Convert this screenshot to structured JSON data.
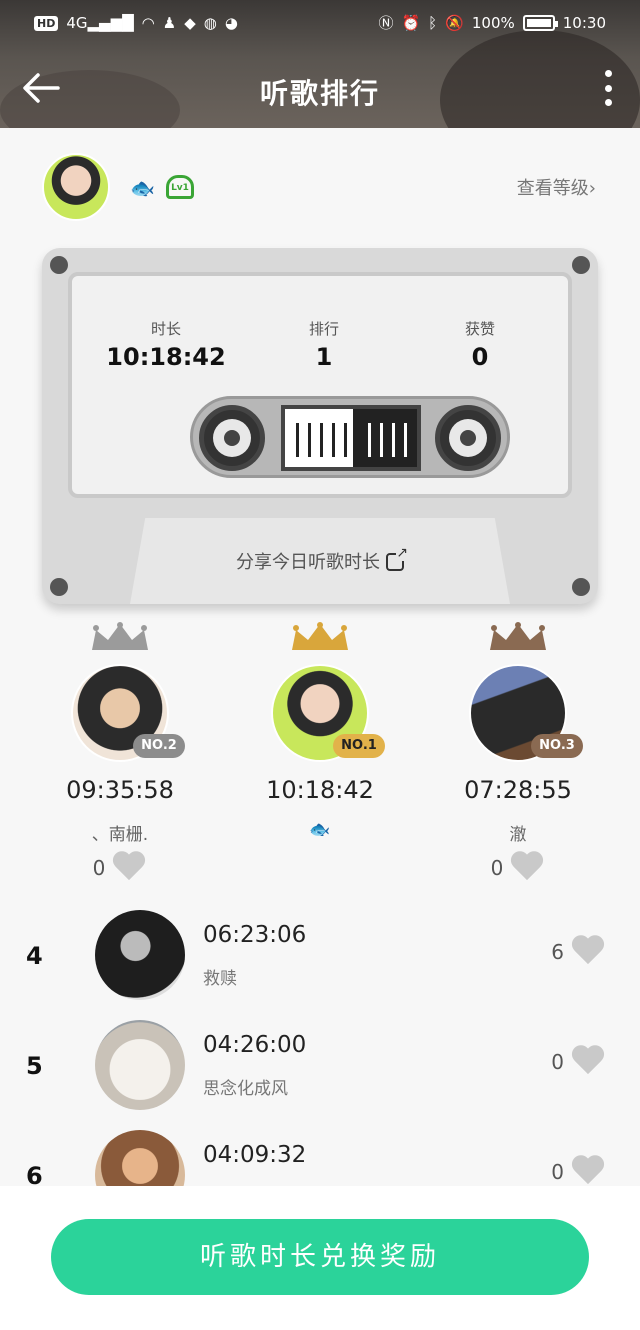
{
  "status_bar": {
    "hd": "HD",
    "network": "4G",
    "battery": "100%",
    "time": "10:30"
  },
  "header": {
    "title": "听歌排行",
    "back_icon": "arrow-left-icon",
    "more_icon": "more-vertical-icon"
  },
  "me": {
    "view_level": "查看等级›",
    "level": "Lv1"
  },
  "cassette": {
    "duration_label": "时长",
    "duration_value": "10:18:42",
    "rank_label": "排行",
    "rank_value": "1",
    "likes_label": "获赞",
    "likes_value": "0",
    "share": "分享今日听歌时长"
  },
  "podium": [
    {
      "badge": "NO.2",
      "time": "09:35:58",
      "name": "、南栅.",
      "likes": "0",
      "crown_color": "#9b9b9b",
      "badge_color": "#8c8c8c"
    },
    {
      "badge": "NO.1",
      "time": "10:18:42",
      "name": "",
      "likes": "",
      "crown_color": "#d9a63b",
      "badge_color": "#e2b24a"
    },
    {
      "badge": "NO.3",
      "time": "07:28:55",
      "name": "澈",
      "likes": "0",
      "crown_color": "#8a6a52",
      "badge_color": "#8a6a52"
    }
  ],
  "ranking": [
    {
      "rank": "4",
      "time": "06:23:06",
      "name": "救赎",
      "likes": "6"
    },
    {
      "rank": "5",
      "time": "04:26:00",
      "name": "思念化成风",
      "likes": "0"
    },
    {
      "rank": "6",
      "time": "04:09:32",
      "name": "",
      "likes": "0"
    }
  ],
  "footer": {
    "button": "听歌时长兑换奖励"
  }
}
